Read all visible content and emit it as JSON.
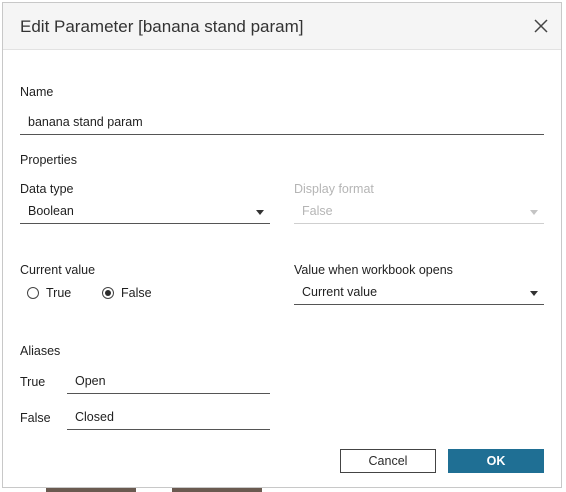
{
  "dialog": {
    "title": "Edit Parameter [banana stand param]",
    "close_icon": "close-icon"
  },
  "name_section": {
    "label": "Name",
    "value": "banana stand param"
  },
  "properties": {
    "label": "Properties",
    "data_type": {
      "label": "Data type",
      "value": "Boolean"
    },
    "display_format": {
      "label": "Display format",
      "value": "False",
      "disabled": true
    }
  },
  "current_value": {
    "label": "Current value",
    "options": [
      {
        "label": "True",
        "selected": false
      },
      {
        "label": "False",
        "selected": true
      }
    ]
  },
  "workbook_opens": {
    "label": "Value when workbook opens",
    "value": "Current value"
  },
  "aliases": {
    "label": "Aliases",
    "rows": [
      {
        "key": "True",
        "value": "Open"
      },
      {
        "key": "False",
        "value": "Closed"
      }
    ]
  },
  "buttons": {
    "cancel": "Cancel",
    "ok": "OK"
  },
  "colors": {
    "primary_button": "#1f6f94",
    "header_bg": "#f5f5f5",
    "disabled_text": "#b5b5b5"
  }
}
